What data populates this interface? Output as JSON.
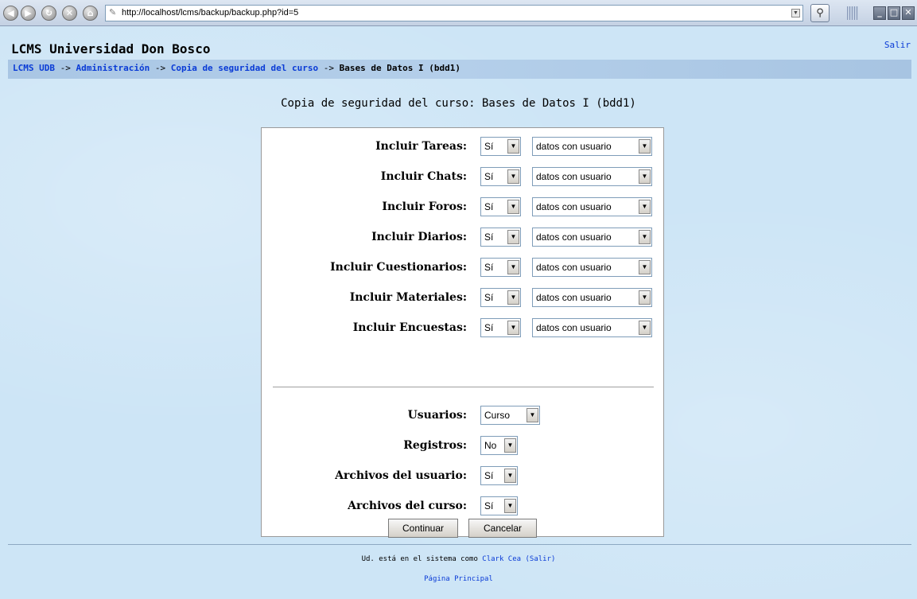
{
  "browser": {
    "url": "http://localhost/lcms/backup/backup.php?id=5"
  },
  "site": {
    "title": "LCMS Universidad Don Bosco",
    "logout": "Salir"
  },
  "breadcrumb": {
    "items": [
      "LCMS UDB",
      "Administración",
      "Copia de seguridad del curso"
    ],
    "separator": "->",
    "current": "Bases de Datos I (bdd1)"
  },
  "heading": "Copia de seguridad del curso: Bases de Datos I (bdd1)",
  "form": {
    "modules": [
      {
        "label": "Incluir Tareas:",
        "include": "Sí",
        "data": "datos con usuario"
      },
      {
        "label": "Incluir Chats:",
        "include": "Sí",
        "data": "datos con usuario"
      },
      {
        "label": "Incluir Foros:",
        "include": "Sí",
        "data": "datos con usuario"
      },
      {
        "label": "Incluir Diarios:",
        "include": "Sí",
        "data": "datos con usuario"
      },
      {
        "label": "Incluir Cuestionarios:",
        "include": "Sí",
        "data": "datos con usuario"
      },
      {
        "label": "Incluir Materiales:",
        "include": "Sí",
        "data": "datos con usuario"
      },
      {
        "label": "Incluir Encuestas:",
        "include": "Sí",
        "data": "datos con usuario"
      }
    ],
    "options": [
      {
        "label": "Usuarios:",
        "value": "Curso"
      },
      {
        "label": "Registros:",
        "value": "No"
      },
      {
        "label": "Archivos del usuario:",
        "value": "Sí"
      },
      {
        "label": "Archivos del curso:",
        "value": "Sí"
      }
    ],
    "continue_label": "Continuar",
    "cancel_label": "Cancelar"
  },
  "footer": {
    "logged_in_prefix": "Ud. está en el sistema como",
    "user_name": "Clark Cea",
    "logout_link": "(Salir)",
    "home_link": "Página Principal"
  }
}
